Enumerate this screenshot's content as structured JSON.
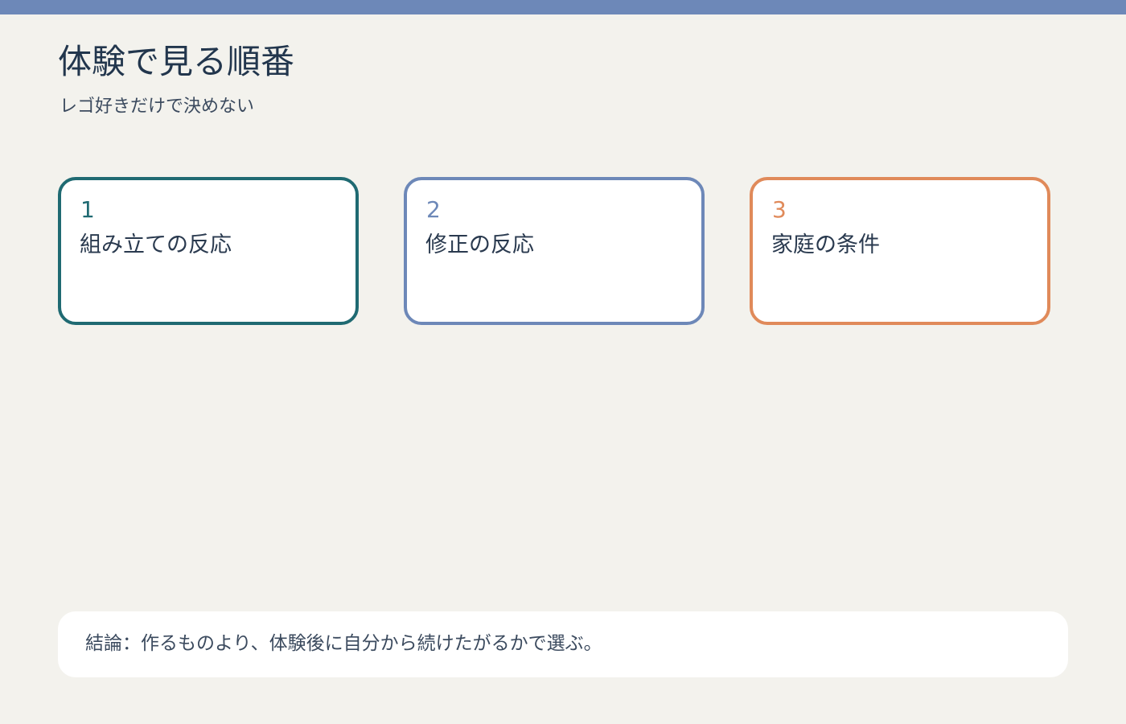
{
  "header": {
    "accent_color": "#6d88b8",
    "title": "体験で見る順番",
    "subtitle": "レゴ好きだけで決めない"
  },
  "cards": [
    {
      "number": "1",
      "label": "組み立ての反応",
      "color": "#1f6a72"
    },
    {
      "number": "2",
      "label": "修正の反応",
      "color": "#6d88b8"
    },
    {
      "number": "3",
      "label": "家庭の条件",
      "color": "#e08a5a"
    }
  ],
  "conclusion": {
    "text": "結論：作るものより、体験後に自分から続けたがるかで選ぶ。"
  }
}
